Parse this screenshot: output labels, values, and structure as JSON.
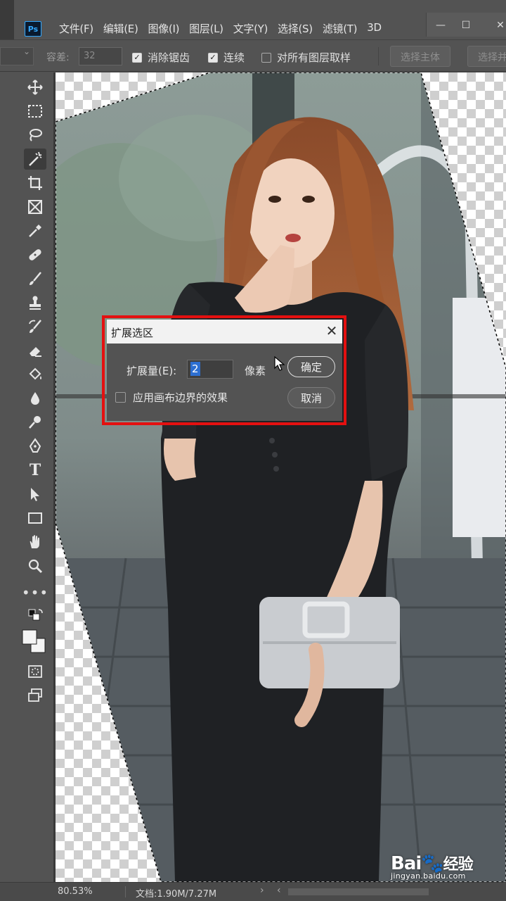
{
  "app": {
    "logo": "Ps"
  },
  "menu": [
    "文件(F)",
    "编辑(E)",
    "图像(I)",
    "图层(L)",
    "文字(Y)",
    "选择(S)",
    "滤镜(T)",
    "3D"
  ],
  "window_controls": {
    "minimize": "—",
    "maximize": "☐",
    "close": "✕"
  },
  "options_bar": {
    "tolerance_label": "容差:",
    "tolerance_value": "32",
    "anti_alias_label": "消除锯齿",
    "anti_alias_checked": true,
    "contiguous_label": "连续",
    "contiguous_checked": true,
    "sample_all_label": "对所有图层取样",
    "sample_all_checked": false,
    "select_subject_label": "选择主体",
    "select_and_mask_label": "选择并"
  },
  "tools": [
    "move-icon",
    "marquee-icon",
    "lasso-icon",
    "magic-wand-icon",
    "crop-icon",
    "frame-icon",
    "eyedropper-icon",
    "healing-icon",
    "brush-icon",
    "stamp-icon",
    "history-brush-icon",
    "eraser-icon",
    "paint-bucket-icon",
    "blur-icon",
    "dodge-icon",
    "pen-icon",
    "type-icon",
    "path-select-icon",
    "rectangle-icon",
    "hand-icon",
    "zoom-icon",
    "more-icon"
  ],
  "dialog": {
    "title": "扩展选区",
    "expand_label": "扩展量(E):",
    "expand_value": "2",
    "unit": "像素",
    "ok_label": "确定",
    "cancel_label": "取消",
    "apply_canvas_label": "应用画布边界的效果",
    "apply_canvas_checked": false,
    "highlight_color": "#e41010"
  },
  "status": {
    "zoom": "80.53%",
    "doc": "文档:1.90M/7.27M",
    "arrow": "›",
    "arrow_left": "‹"
  },
  "watermark": {
    "brand_a": "Bai",
    "brand_b": "经验",
    "site": "jingyan.baidu.com"
  }
}
